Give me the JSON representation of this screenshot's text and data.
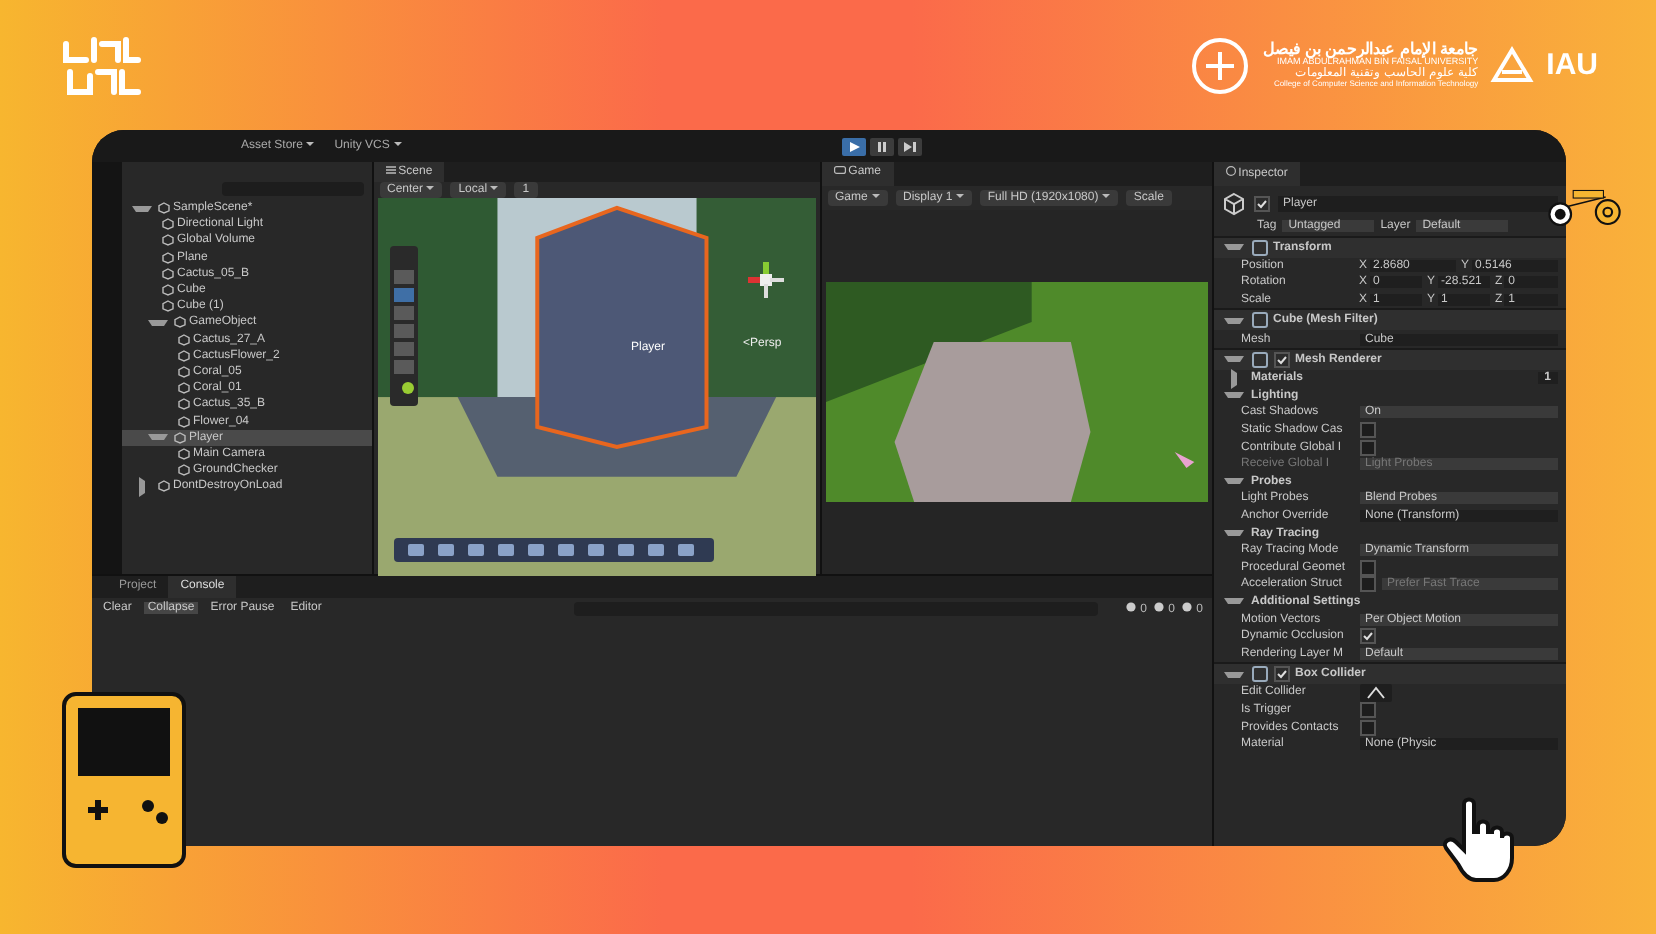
{
  "branding": {
    "university_ar": "جامعة الإمام عبدالرحمن بن فيصل",
    "university_en": "IMAM ABDULRAHMAN BIN FAISAL UNIVERSITY",
    "college_ar": "كلية علوم الحاسب وتقنية المعلومات",
    "college_en": "College of Computer Science and Information Technology",
    "short": "IAU"
  },
  "toolbar": {
    "items": [
      "Asset Store",
      "Unity VCS"
    ]
  },
  "hierarchy": {
    "items": [
      {
        "label": "SampleScene*",
        "selected": false,
        "expanded": true,
        "children": [
          {
            "label": "Directional Light",
            "selected": false
          },
          {
            "label": "Global Volume",
            "selected": false
          },
          {
            "label": "Plane",
            "selected": false
          },
          {
            "label": "Cactus_05_B",
            "selected": false
          },
          {
            "label": "Cube",
            "selected": false
          },
          {
            "label": "Cube (1)",
            "selected": false
          },
          {
            "label": "GameObject",
            "selected": false,
            "expanded": true,
            "children": [
              {
                "label": "Cactus_27_A",
                "selected": false
              },
              {
                "label": "CactusFlower_2",
                "selected": false
              },
              {
                "label": "Coral_05",
                "selected": false
              },
              {
                "label": "Coral_01",
                "selected": false
              },
              {
                "label": "Cactus_35_B",
                "selected": false
              },
              {
                "label": "Flower_04",
                "selected": false
              }
            ]
          },
          {
            "label": "Player",
            "selected": true,
            "expanded": true,
            "children": [
              {
                "label": "Main Camera",
                "selected": false
              },
              {
                "label": "GroundChecker",
                "selected": false
              }
            ]
          }
        ]
      },
      {
        "label": "DontDestroyOnLoad",
        "selected": false,
        "expanded": false
      }
    ]
  },
  "scene": {
    "tab": "Scene",
    "pivot": "Center",
    "space": "Local",
    "snap": "1",
    "object_label": "Player",
    "view_label": "<Persp"
  },
  "game": {
    "tab": "Game",
    "mode": "Game",
    "display": "Display 1",
    "resolution": "Full HD (1920x1080)",
    "scale": "Scale"
  },
  "inspector": {
    "tab": "Inspector",
    "object": "Player",
    "active": true,
    "tag_label": "Tag",
    "tag": "Untagged",
    "layer_label": "Layer",
    "layer": "Default",
    "components": [
      {
        "name": "Transform",
        "expanded": true,
        "rows": [
          {
            "kind": "vector",
            "label": "Position",
            "values": [
              {
                "axis": "X",
                "value": "2.8680"
              },
              {
                "axis": "Y",
                "value": "0.5146"
              }
            ]
          },
          {
            "kind": "vector",
            "label": "Rotation",
            "values": [
              {
                "axis": "X",
                "value": "0"
              },
              {
                "axis": "Y",
                "value": "-28.521"
              },
              {
                "axis": "Z",
                "value": "0"
              }
            ]
          },
          {
            "kind": "vector",
            "label": "Scale",
            "values": [
              {
                "axis": "X",
                "value": "1"
              },
              {
                "axis": "Y",
                "value": "1"
              },
              {
                "axis": "Z",
                "value": "1"
              }
            ]
          }
        ]
      },
      {
        "name": "Cube (Mesh Filter)",
        "expanded": true,
        "rows": [
          {
            "kind": "object",
            "label": "Mesh",
            "value": "Cube"
          }
        ]
      },
      {
        "name": "Mesh Renderer",
        "enabled": true,
        "expanded": true,
        "rows": [
          {
            "kind": "group",
            "label": "Materials",
            "expanded": false,
            "value": "1"
          },
          {
            "kind": "group",
            "label": "Lighting",
            "expanded": true
          },
          {
            "kind": "dropdown",
            "label": "Cast Shadows",
            "value": "On"
          },
          {
            "kind": "check",
            "label": "Static Shadow Cas",
            "checked": false
          },
          {
            "kind": "check",
            "label": "Contribute Global I",
            "checked": false
          },
          {
            "kind": "greyed",
            "label": "Receive Global I",
            "value": "Light Probes"
          },
          {
            "kind": "group",
            "label": "Probes",
            "expanded": true
          },
          {
            "kind": "dropdown",
            "label": "Light Probes",
            "value": "Blend Probes"
          },
          {
            "kind": "object",
            "label": "Anchor Override",
            "value": "None (Transform)"
          },
          {
            "kind": "group",
            "label": "Ray Tracing",
            "expanded": true
          },
          {
            "kind": "dropdown",
            "label": "Ray Tracing Mode",
            "value": "Dynamic Transform"
          },
          {
            "kind": "check",
            "label": "Procedural Geomet",
            "checked": false
          },
          {
            "kind": "check",
            "label": "Acceleration Struct",
            "checked": false,
            "value": "Prefer Fast Trace"
          },
          {
            "kind": "group",
            "label": "Additional Settings",
            "expanded": true
          },
          {
            "kind": "dropdown",
            "label": "Motion Vectors",
            "value": "Per Object Motion"
          },
          {
            "kind": "check",
            "label": "Dynamic Occlusion",
            "checked": true
          },
          {
            "kind": "dropdown",
            "label": "Rendering Layer M",
            "value": "Default"
          }
        ]
      },
      {
        "name": "Box Collider",
        "enabled": true,
        "expanded": true,
        "rows": [
          {
            "kind": "edit",
            "label": "Edit Collider"
          },
          {
            "kind": "check",
            "label": "Is Trigger",
            "checked": false
          },
          {
            "kind": "check",
            "label": "Provides Contacts",
            "checked": false
          },
          {
            "kind": "object",
            "label": "Material",
            "value": "None (Physic"
          }
        ]
      }
    ]
  },
  "console": {
    "tabs": [
      {
        "label": "Project",
        "selected": false
      },
      {
        "label": "Console",
        "selected": true
      }
    ],
    "buttons": [
      {
        "label": "Clear",
        "selected": false
      },
      {
        "label": "Collapse",
        "selected": true
      },
      {
        "label": "Error Pause",
        "selected": false
      },
      {
        "label": "Editor",
        "selected": false
      }
    ],
    "counts": [
      "0",
      "0",
      "0"
    ]
  }
}
